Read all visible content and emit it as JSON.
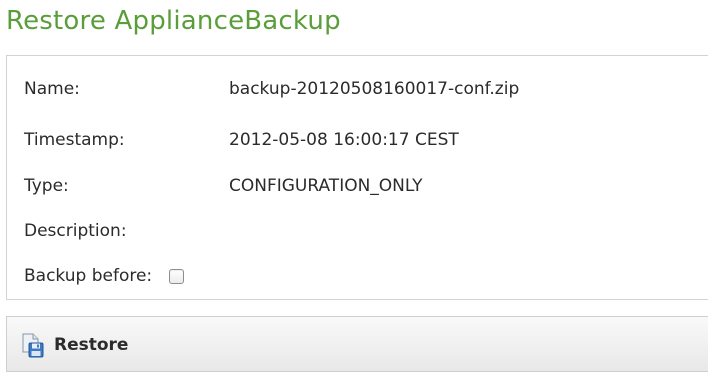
{
  "page": {
    "title": "Restore ApplianceBackup"
  },
  "details": {
    "name_label": "Name:",
    "name_value": "backup-20120508160017-conf.zip",
    "timestamp_label": "Timestamp:",
    "timestamp_value": "2012-05-08 16:00:17 CEST",
    "type_label": "Type:",
    "type_value": "CONFIGURATION_ONLY",
    "description_label": "Description:",
    "description_value": "",
    "backup_before_label": "Backup before:",
    "backup_before_checked": false
  },
  "toolbar": {
    "restore_label": "Restore",
    "restore_icon": "restore-disk-icon"
  },
  "colors": {
    "title": "#5a9e3a",
    "text": "#2b2b2b",
    "border": "#d3d3d3"
  }
}
